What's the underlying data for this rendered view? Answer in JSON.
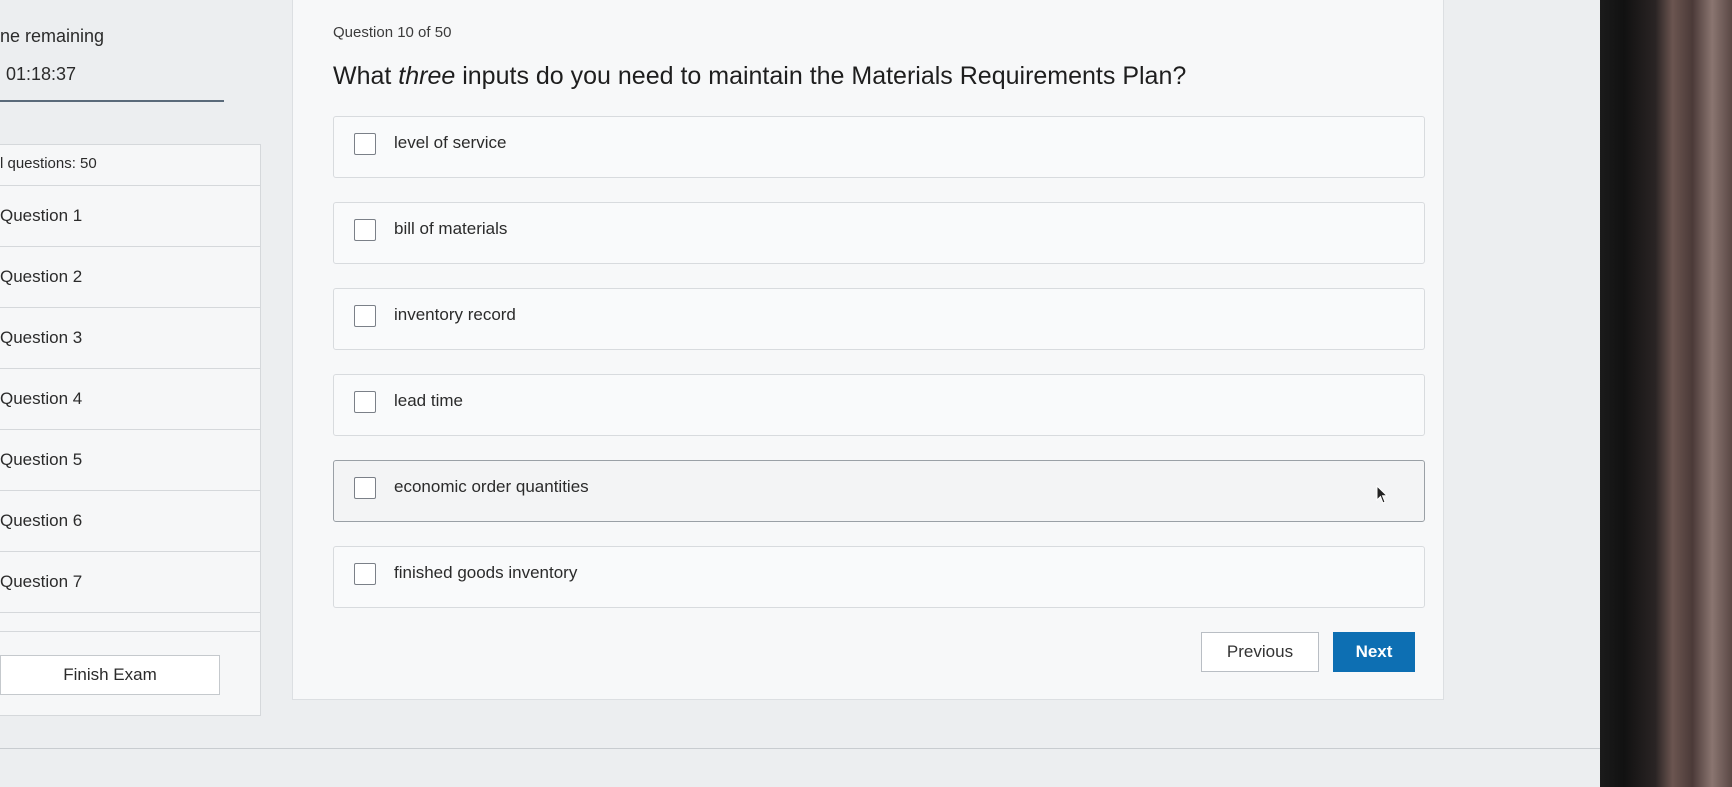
{
  "sidebar": {
    "time_label": "ne remaining",
    "time_value": "01:18:37",
    "total_questions": "l questions: 50",
    "questions": [
      "Question 1",
      "Question 2",
      "Question 3",
      "Question 4",
      "Question 5",
      "Question 6",
      "Question 7"
    ],
    "finish_label": "Finish Exam"
  },
  "question": {
    "counter": "Question 10 of 50",
    "text_before": "What ",
    "text_em": "three",
    "text_after": " inputs do you need to maintain the Materials Requirements Plan?",
    "options": [
      {
        "label": "level of service",
        "checked": false
      },
      {
        "label": "bill of materials",
        "checked": false
      },
      {
        "label": "inventory record",
        "checked": false
      },
      {
        "label": "lead time",
        "checked": false
      },
      {
        "label": "economic order quantities",
        "checked": false
      },
      {
        "label": "finished goods inventory",
        "checked": false
      }
    ]
  },
  "nav": {
    "previous_label": "Previous",
    "next_label": "Next"
  },
  "colors": {
    "accent": "#0d6fb3",
    "background": "#eceef0"
  },
  "icons": {
    "checkbox": "checkbox-icon",
    "cursor": "mouse-pointer-icon"
  }
}
